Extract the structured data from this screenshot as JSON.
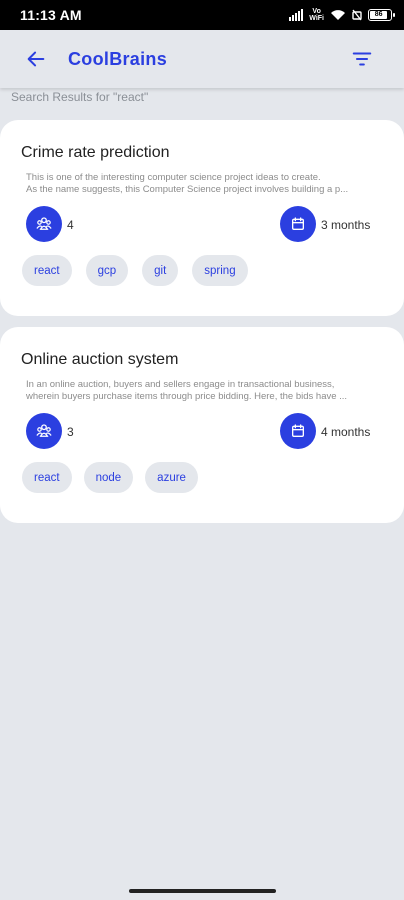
{
  "status_bar": {
    "time": "11:13 AM",
    "network_top": "Vo",
    "network_bottom": "WiFi",
    "battery": "86"
  },
  "app_bar": {
    "title": "CoolBrains",
    "back_icon": "arrow-left-icon",
    "filter_icon": "filter-list-icon"
  },
  "results_label": "Search Results for \"react\"",
  "projects": [
    {
      "title": "Crime rate prediction",
      "description_line1": "This is one of the interesting computer science project ideas to create.",
      "description_line2": "As the name suggests, this Computer Science project involves building a p...",
      "team_size": "4",
      "duration": "3 months",
      "tags": [
        "react",
        "gcp",
        "git",
        "spring"
      ]
    },
    {
      "title": "Online auction system",
      "description_line1": "In an online auction, buyers and sellers engage in transactional business,",
      "description_line2": "wherein buyers purchase items through price bidding. Here, the bids have ...",
      "team_size": "3",
      "duration": "4 months",
      "tags": [
        "react",
        "node",
        "azure"
      ]
    }
  ],
  "colors": {
    "accent": "#2b3fe0",
    "background": "#e4e7ec",
    "card": "#ffffff"
  }
}
